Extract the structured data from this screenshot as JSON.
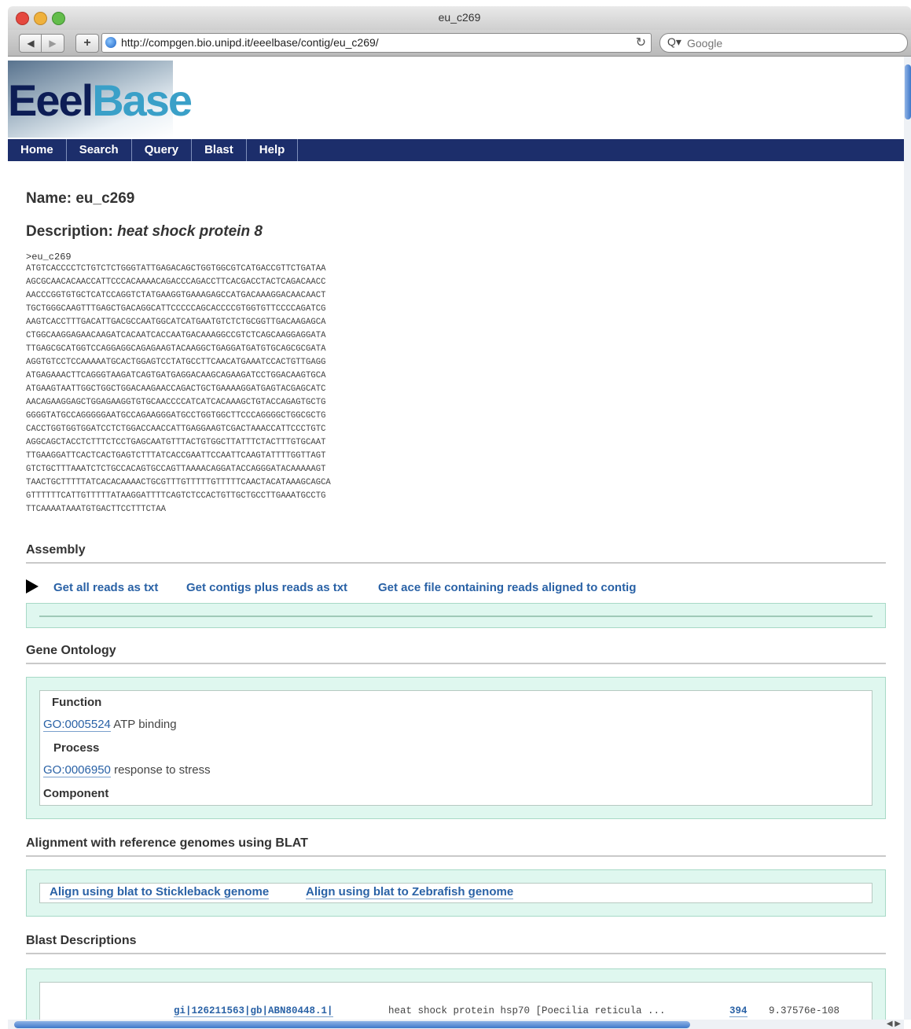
{
  "window": {
    "title": "eu_c269"
  },
  "toolbar": {
    "back_glyph": "◀",
    "forward_glyph": "▶",
    "add_glyph": "+",
    "url": "http://compgen.bio.unipd.it/eeelbase/contig/eu_c269/",
    "reload_glyph": "↻",
    "search_glyph": "Q▾",
    "search_placeholder": "Google"
  },
  "logo": {
    "part1": "Eeel",
    "part2": "Base"
  },
  "nav": {
    "items": [
      "Home",
      "Search",
      "Query",
      "Blast",
      "Help"
    ]
  },
  "contig": {
    "name_label": "Name:",
    "name": "eu_c269",
    "description_label": "Description:",
    "description": "heat shock protein 8",
    "sequence_header": ">eu_c269",
    "sequence": [
      "ATGTCACCCCTCTGTCTCTGGGTATTGAGACAGCTGGTGGCGTCATGACCGTTCTGATAA",
      "AGCGCAACACAACCATTCCCACAAAACAGACCCAGACCTTCACGACCTACTCAGACAACC",
      "AACCCGGTGTGCTCATCCAGGTCTATGAAGGTGAAAGAGCCATGACAAAGGACAACAACT",
      "TGCTGGGCAAGTTTGAGCTGACAGGCATTCCCCCAGCACCCCGTGGTGTTCCCCAGATCG",
      "AAGTCACCTTTGACATTGACGCCAATGGCATCATGAATGTCTCTGCGGTTGACAAGAGCA",
      "CTGGCAAGGAGAACAAGATCACAATCACCAATGACAAAGGCCGTCTCAGCAAGGAGGATA",
      "TTGAGCGCATGGTCCAGGAGGCAGAGAAGTACAAGGCTGAGGATGATGTGCAGCGCGATA",
      "AGGTGTCCTCCAAAAATGCACTGGAGTCCTATGCCTTCAACATGAAATCCACTGTTGAGG",
      "ATGAGAAACTTCAGGGTAAGATCAGTGATGAGGACAAGCAGAAGATCCTGGACAAGTGCA",
      "ATGAAGTAATTGGCTGGCTGGACAAGAACCAGACTGCTGAAAAGGATGAGTACGAGCATC",
      "AACAGAAGGAGCTGGAGAAGGTGTGCAACCCCATCATCACAAAGCTGTACCAGAGTGCTG",
      "GGGGTATGCCAGGGGGAATGCCAGAAGGGATGCCTGGTGGCTTCCCAGGGGCTGGCGCTG",
      "CACCTGGTGGTGGATCCTCTGGACCAACCATTGAGGAAGTCGACTAAACCATTCCCTGTC",
      "AGGCAGCTACCTCTTTCTCCTGAGCAATGTTTACTGTGGCTTATTTCTACTTTGTGCAAT",
      "TTGAAGGATTCACTCACTGAGTCTTTATCACCGAATTCCAATTCAAGTATTTTGGTTAGT",
      "GTCTGCTTTAAATCTCTGCCACAGTGCCAGTTAAAACAGGATACCAGGGATACAAAAAGT",
      "TAACTGCTTTTTATCACACAAAACTGCGTTTGTTTTTGTTTTTCAACTACATAAAGCAGCA",
      "GTTTTTTCATTGTTTTTATAAGGATTTTCAGTCTCCACTGTTGCTGCCTTGAAATGCCTG",
      "TTCAAAATAAATGTGACTTCCTTTCTAA"
    ]
  },
  "assembly": {
    "title": "Assembly",
    "links": [
      "Get all reads as txt",
      "Get contigs plus reads as txt",
      "Get ace file containing reads aligned to contig"
    ]
  },
  "gene_ontology": {
    "title": "Gene Ontology",
    "function_label": "Function",
    "function_id": "GO:0005524",
    "function_term": "ATP binding",
    "process_label": "Process",
    "process_id": "GO:0006950",
    "process_term": "response to stress",
    "component_label": "Component"
  },
  "blat": {
    "title": "Alignment with reference genomes using BLAT",
    "links": [
      "Align using blat to Stickleback genome",
      "Align using blat to Zebrafish genome"
    ]
  },
  "blast": {
    "title": "Blast Descriptions",
    "rows": [
      {
        "accession": "gi|126211563|gb|ABN80448.1|",
        "description": "heat shock protein hsp70 [Poecilia reticula ...",
        "score": "394",
        "evalue": "9.37576e-108"
      }
    ]
  },
  "colors": {
    "nav_bg": "#1c2e6b",
    "link": "#2a62a6",
    "panel_bg": "#dff7ef",
    "logo_dark": "#0d1d55",
    "logo_light": "#3aa0c8"
  }
}
